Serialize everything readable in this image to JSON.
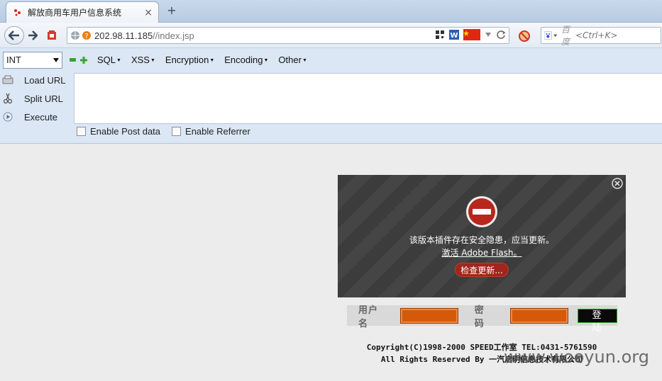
{
  "tab": {
    "title": "解放商用车用户信息系统",
    "close": "×",
    "new_tab": "+"
  },
  "address": {
    "host": "202.98.11.185",
    "path": "//index.jsp"
  },
  "search": {
    "engine": "百度",
    "placeholder": "<Ctrl+K>"
  },
  "hackbar": {
    "select_value": "INT",
    "menus": [
      "SQL",
      "XSS",
      "Encryption",
      "Encoding",
      "Other"
    ],
    "actions": [
      "Load URL",
      "Split URL",
      "Execute"
    ],
    "checks": [
      "Enable Post data",
      "Enable Referrer"
    ]
  },
  "flash": {
    "message": "该版本插件存在安全隐患，应当更新。",
    "activate": "激活 Adobe Flash。",
    "update_button": "检查更新..."
  },
  "login": {
    "username_label": "用户名",
    "password_label": "密 码",
    "submit_label": "登 陆"
  },
  "copyright": {
    "line1": "Copyright(C)1998-2000 SPEED工作室  TEL:0431-5761590",
    "line2": "All Rights Reserved By 一汽启明信息技术有限公司"
  },
  "watermark": "www.wooyun.org",
  "colors": {
    "accent_orange": "#d45a0a",
    "flash_red": "#a0261c",
    "hackbar_bg": "#dbe7f5"
  }
}
